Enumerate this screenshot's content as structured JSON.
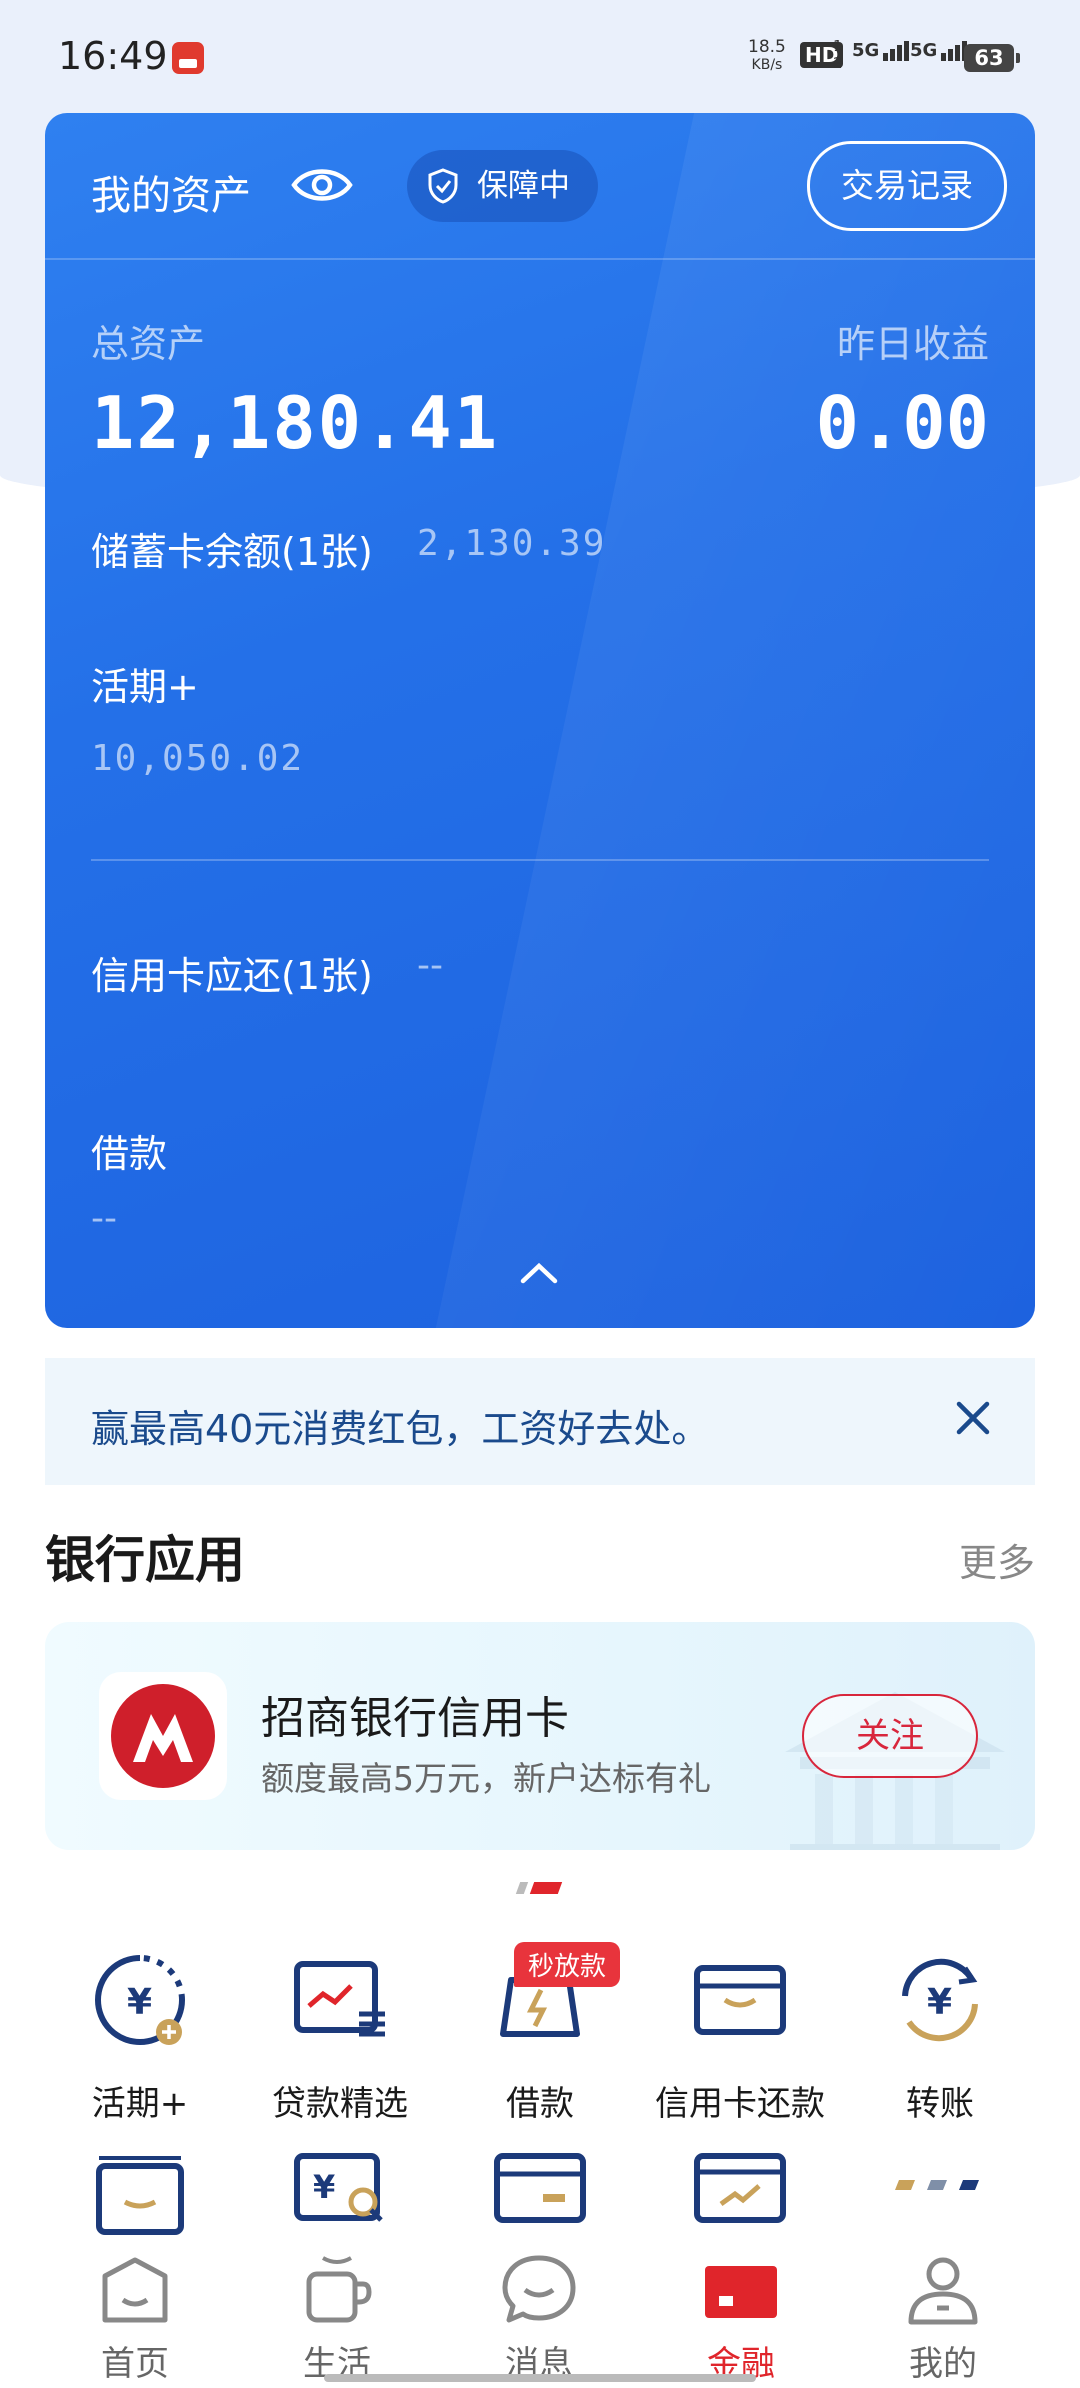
{
  "status_bar": {
    "time": "16:49",
    "net_speed_value": "18.5",
    "net_speed_unit": "KB/s",
    "hd_label": "HD",
    "sim_nums": "1 2",
    "signal_1": "5G",
    "signal_2": "5G",
    "battery": "63"
  },
  "asset_card": {
    "title": "我的资产",
    "guard_label": "保障中",
    "records_button": "交易记录",
    "total_assets_label": "总资产",
    "total_assets_value": "12,180.41",
    "yesterday_income_label": "昨日收益",
    "yesterday_income_value": "0.00",
    "debit_label": "储蓄卡余额(1张)",
    "debit_value": "2,130.39",
    "current_plus_label": "活期+",
    "current_plus_value": "10,050.02",
    "credit_label": "信用卡应还(1张)",
    "credit_value": "--",
    "loan_label": "借款",
    "loan_value": "--"
  },
  "promo": {
    "text": "赢最高40元消费红包，工资好去处。"
  },
  "bank_apps": {
    "title": "银行应用",
    "more": "更多",
    "featured": {
      "name": "招商银行信用卡",
      "subtitle": "额度最高5万元，新户达标有礼",
      "follow_button": "关注"
    },
    "grid_row1": [
      {
        "label": "活期+",
        "icon": "yen-clock-icon"
      },
      {
        "label": "贷款精选",
        "icon": "loan-chart-icon"
      },
      {
        "label": "借款",
        "icon": "borrow-bag-icon",
        "tag": "秒放款"
      },
      {
        "label": "信用卡还款",
        "icon": "credit-card-repay-icon"
      },
      {
        "label": "转账",
        "icon": "transfer-yen-icon"
      }
    ],
    "grid_row2_icons": [
      "wallet-icon",
      "yen-search-icon",
      "bank-card-icon",
      "card-trend-icon",
      "more-dots-icon"
    ]
  },
  "bottom_nav": [
    {
      "label": "首页",
      "icon": "home-icon"
    },
    {
      "label": "生活",
      "icon": "cup-icon"
    },
    {
      "label": "消息",
      "icon": "chat-icon"
    },
    {
      "label": "金融",
      "icon": "finance-icon",
      "active": true
    },
    {
      "label": "我的",
      "icon": "profile-icon"
    }
  ],
  "colors": {
    "card_blue": "#2470e8",
    "accent_red": "#e0252b",
    "navy_icon": "#1c3a7a",
    "gold_icon": "#c9a25a"
  }
}
